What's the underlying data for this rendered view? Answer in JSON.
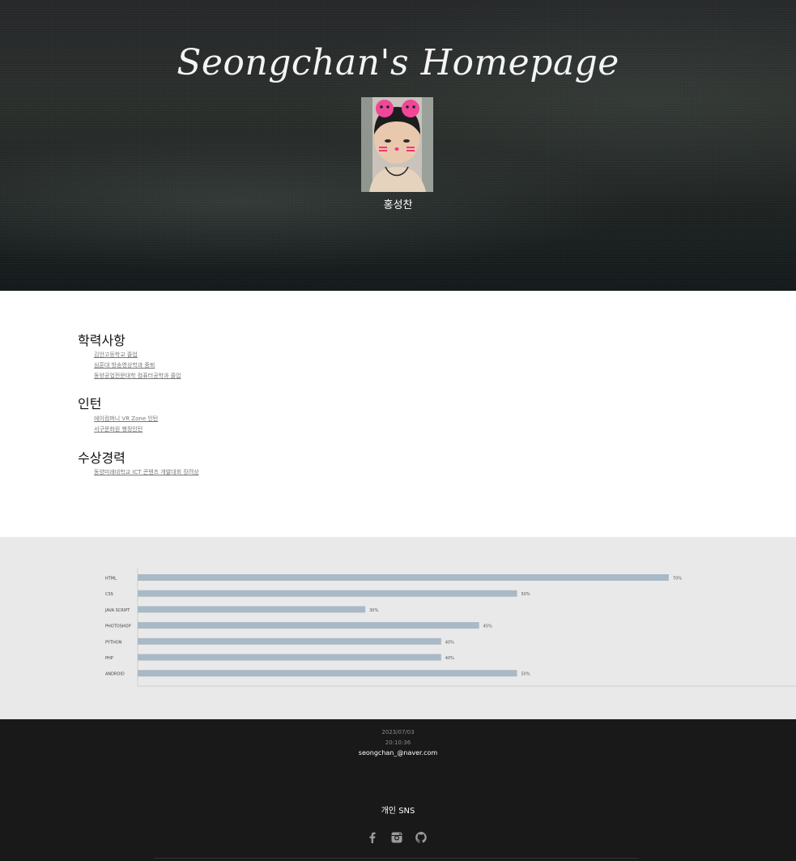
{
  "hero": {
    "title": "Seongchan's Homepage",
    "name": "홍성찬"
  },
  "profile": {
    "sections": [
      {
        "title": "학력사항",
        "items": [
          "김안고등학교 졸업",
          "심훈대 방송영상학과 중퇴",
          "동양공업전문대학 컴퓨터공학과 졸업"
        ]
      },
      {
        "title": "인턴",
        "items": [
          "에이컴퍼니 VR Zone 인턴",
          "서구문화원 행정인턴"
        ]
      },
      {
        "title": "수상경력",
        "items": [
          "동양미래대학교 ICT 콘텐츠 개발대회 장려상"
        ]
      }
    ]
  },
  "chart_data": {
    "type": "bar",
    "orientation": "horizontal",
    "categories": [
      "HTML",
      "CSS",
      "JAVA SCRIPT",
      "PHOTOSHOP",
      "PYTHON",
      "PHP",
      "ANDROID"
    ],
    "values": [
      70,
      50,
      30,
      45,
      40,
      40,
      50
    ],
    "value_labels": [
      "70%",
      "50%",
      "30%",
      "45%",
      "40%",
      "40%",
      "50%"
    ],
    "xlim": [
      0,
      100
    ],
    "bar_color": "#a9b9c5"
  },
  "footer": {
    "date": "2023/07/03",
    "time": "20:10:36",
    "email": "seongchan_@naver.com",
    "sns_title": "개인 SNS",
    "icons": [
      "facebook-icon",
      "instagram-icon",
      "github-icon"
    ]
  }
}
